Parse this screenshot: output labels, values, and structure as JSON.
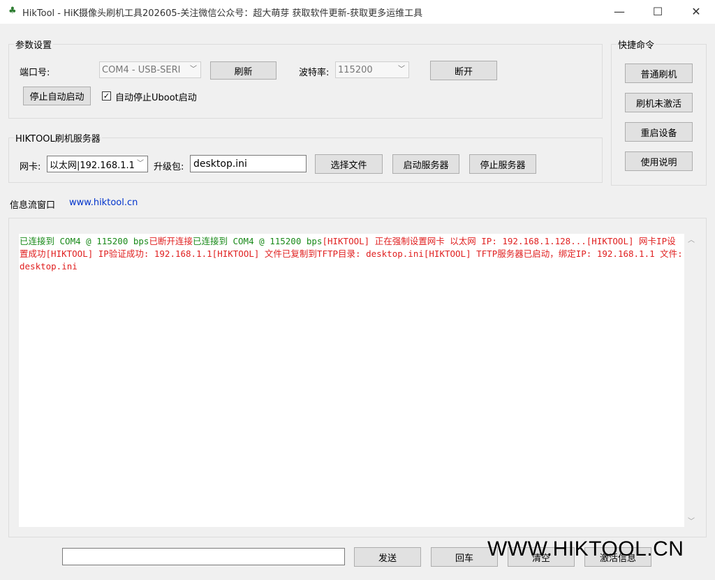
{
  "window": {
    "title": "HikTool - HiK摄像头刷机工具202605-关注微信公众号：超大萌芽 获取软件更新-获取更多运维工具",
    "icon": "tree-icon",
    "minimize_glyph": "—",
    "maximize_glyph": "☐",
    "close_glyph": "✕"
  },
  "params": {
    "title": "参数设置",
    "port_label": "端口号:",
    "port_value": "COM4 - USB-SERI",
    "refresh_label": "刷新",
    "baud_label": "波特率:",
    "baud_value": "115200",
    "disconnect_label": "断开",
    "stop_auto_label": "停止自动启动",
    "checkbox_label": "自动停止Uboot启动",
    "checkbox_checked": true
  },
  "server": {
    "title": "HIKTOOL刷机服务器",
    "nic_label": "网卡:",
    "nic_value": "以太网|192.168.1.1",
    "package_label": "升级包:",
    "package_value": "desktop.ini",
    "select_file_label": "选择文件",
    "start_server_label": "启动服务器",
    "stop_server_label": "停止服务器"
  },
  "quick": {
    "title": "快捷命令",
    "buttons": [
      "普通刷机",
      "刷机未激活",
      "重启设备",
      "使用说明"
    ]
  },
  "info": {
    "title": "信息流窗口",
    "link": "www.hiktool.cn"
  },
  "log": [
    {
      "color": "green",
      "text": "已连接到 COM4 @ 115200 bps"
    },
    {
      "color": "red",
      "text": "已断开连接"
    },
    {
      "color": "green",
      "text": "已连接到 COM4 @ 115200 bps"
    },
    {
      "color": "red",
      "text": "[HIKTOOL] 正在强制设置网卡 以太网 IP: 192.168.1.128..."
    },
    {
      "color": "red",
      "text": "[HIKTOOL] 网卡IP设置成功"
    },
    {
      "color": "red",
      "text": "[HIKTOOL] IP验证成功: 192.168.1.1"
    },
    {
      "color": "red",
      "text": "[HIKTOOL] 文件已复制到TFTP目录: desktop.ini"
    },
    {
      "color": "red",
      "text": "[HIKTOOL] TFTP服务器已启动，绑定IP: 192.168.1.1 文件: desktop.ini"
    }
  ],
  "bottom": {
    "send_input_value": "",
    "send_label": "发送",
    "enter_label": "回车",
    "clear_label": "清空",
    "activate_label": "激活信息"
  },
  "watermark": "WWW.HIKTOOL.CN",
  "colors": {
    "log_green": "#1a8a1a",
    "log_red": "#e02020",
    "link_blue": "#0033cc"
  }
}
